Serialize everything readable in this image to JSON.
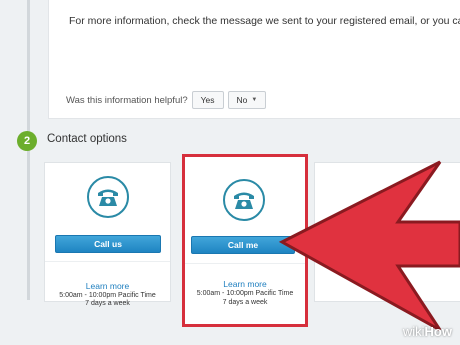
{
  "info": {
    "text": "For more information, check the message we sent to your registered email, or you can c"
  },
  "helpful": {
    "question": "Was this information helpful?",
    "yes_label": "Yes",
    "no_label": "No"
  },
  "section": {
    "step_number": "2",
    "title": "Contact options"
  },
  "cards": [
    {
      "button_label": "Call us",
      "learn_more": "Learn more",
      "hours": "5:00am - 10:00pm Pacific Time",
      "days": "7 days a week"
    },
    {
      "button_label": "Call me",
      "learn_more": "Learn more",
      "hours": "5:00am - 10:00pm Pacific Time",
      "days": "7 days a week"
    }
  ],
  "watermark": {
    "prefix": "wiki",
    "suffix": "How"
  },
  "colors": {
    "accent_blue": "#1f84c2",
    "highlight_red": "#d62f3c",
    "step_green": "#6cae2c",
    "phone_teal": "#2a8aa6"
  }
}
